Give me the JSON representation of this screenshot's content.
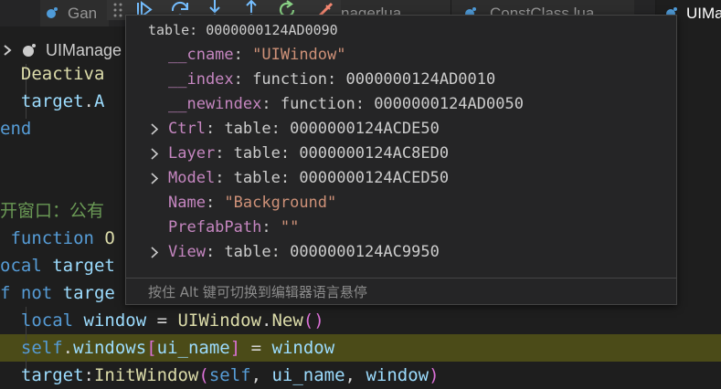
{
  "tabs": [
    {
      "label": "Gan",
      "active": false
    },
    {
      "label": "nagerlua",
      "active": false
    },
    {
      "label": "ConstClass.lua",
      "active": false
    },
    {
      "label": "UIMa",
      "active": true
    }
  ],
  "debug_toolbar": {
    "buttons": [
      "continue-icon",
      "step-over-icon",
      "step-into-icon",
      "step-out-icon",
      "restart-icon",
      "disconnect-icon"
    ]
  },
  "breadcrumb": {
    "label": "UIManage"
  },
  "code_lines": [
    {
      "segments": [
        {
          "t": "  Deactiva",
          "c": "fn"
        }
      ]
    },
    {
      "segments": [
        {
          "t": "  target",
          "c": "var"
        },
        {
          "t": ".",
          "c": "pl"
        },
        {
          "t": "A",
          "c": "var"
        }
      ]
    },
    {
      "segments": [
        {
          "t": "end",
          "c": "kw"
        }
      ]
    },
    {
      "segments": [
        {
          "t": "",
          "c": "pl"
        }
      ]
    },
    {
      "segments": [
        {
          "t": "开窗口：公有",
          "c": "cm"
        }
      ]
    },
    {
      "segments": [
        {
          "t": " function ",
          "c": "kw"
        },
        {
          "t": "O",
          "c": "fn"
        }
      ]
    },
    {
      "segments": [
        {
          "t": "ocal ",
          "c": "kw"
        },
        {
          "t": "target",
          "c": "var"
        }
      ]
    },
    {
      "segments": [
        {
          "t": "f ",
          "c": "kw"
        },
        {
          "t": "not ",
          "c": "kw"
        },
        {
          "t": "targe",
          "c": "var"
        }
      ]
    },
    {
      "segments": [
        {
          "t": "  local ",
          "c": "kw"
        },
        {
          "t": "window",
          "c": "var"
        },
        {
          "t": " = ",
          "c": "pl"
        },
        {
          "t": "UIWindow",
          "c": "fn"
        },
        {
          "t": ".",
          "c": "pl"
        },
        {
          "t": "New",
          "c": "fn"
        },
        {
          "t": "()",
          "c": "br"
        }
      ]
    },
    {
      "segments": [
        {
          "t": "  ",
          "c": "pl"
        },
        {
          "t": "self",
          "c": "self"
        },
        {
          "t": ".",
          "c": "pl"
        },
        {
          "t": "windows",
          "c": "var"
        },
        {
          "t": "[",
          "c": "br"
        },
        {
          "t": "ui_name",
          "c": "var"
        },
        {
          "t": "]",
          "c": "br"
        },
        {
          "t": " = ",
          "c": "pl"
        },
        {
          "t": "window",
          "c": "var"
        }
      ]
    },
    {
      "segments": [
        {
          "t": "  target",
          "c": "var"
        },
        {
          "t": ":",
          "c": "pl"
        },
        {
          "t": "InitWindow",
          "c": "fn"
        },
        {
          "t": "(",
          "c": "br"
        },
        {
          "t": "self",
          "c": "self"
        },
        {
          "t": ", ",
          "c": "pl"
        },
        {
          "t": "ui_name",
          "c": "var"
        },
        {
          "t": ", ",
          "c": "pl"
        },
        {
          "t": "window",
          "c": "var"
        },
        {
          "t": ")",
          "c": "br"
        }
      ]
    }
  ],
  "hover": {
    "title": "table: 0000000124AD0090",
    "rows": [
      {
        "key": "__cname",
        "value": "\"UIWindow\"",
        "type": "string",
        "expandable": false
      },
      {
        "key": "__index",
        "value": "function: 0000000124AD0010",
        "type": "plain",
        "expandable": false
      },
      {
        "key": "__newindex",
        "value": "function: 0000000124AD0050",
        "type": "plain",
        "expandable": false
      },
      {
        "key": "Ctrl",
        "value": "table: 0000000124ACDE50",
        "type": "plain",
        "expandable": true
      },
      {
        "key": "Layer",
        "value": "table: 0000000124AC8ED0",
        "type": "plain",
        "expandable": true
      },
      {
        "key": "Model",
        "value": "table: 0000000124ACED50",
        "type": "plain",
        "expandable": true
      },
      {
        "key": "Name",
        "value": "\"Background\"",
        "type": "string",
        "expandable": false
      },
      {
        "key": "PrefabPath",
        "value": "\"\"",
        "type": "string",
        "expandable": false
      },
      {
        "key": "View",
        "value": "table: 0000000124AC9950",
        "type": "plain",
        "expandable": true
      }
    ],
    "footer": "按住 Alt 键可切换到编辑器语言悬停"
  },
  "colors": {
    "editor_bg": "#1e1e1e",
    "highlight_line": "#4b4b18",
    "keyword": "#569cd6",
    "function": "#dcdcaa",
    "variable": "#9cdcfe",
    "string": "#ce9178",
    "property_key": "#c586c0",
    "comment": "#6a9955"
  }
}
